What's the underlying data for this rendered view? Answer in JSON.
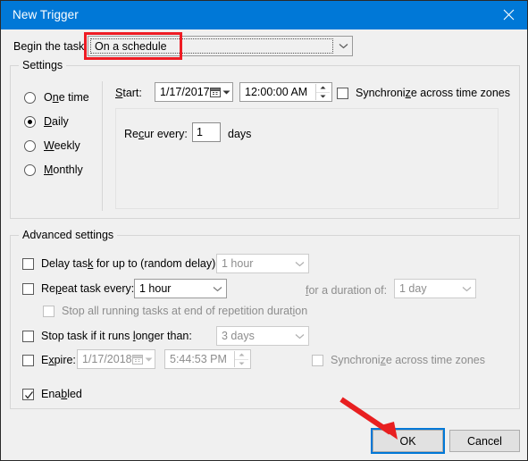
{
  "window": {
    "title": "New Trigger",
    "close_icon": "close-icon",
    "accent_color": "#0078d7",
    "body_color": "#f0f0f0"
  },
  "begin": {
    "label": "Begin the task:",
    "value": "On a schedule",
    "arrow_icon": "chevron-down-icon",
    "highlight_color": "#ee1c24"
  },
  "settings": {
    "title": "Settings",
    "radios": [
      {
        "label": "One time",
        "selected": false
      },
      {
        "label": "Daily",
        "selected": true
      },
      {
        "label": "Weekly",
        "selected": false
      },
      {
        "label": "Monthly",
        "selected": false
      }
    ],
    "start": {
      "label": "Start:",
      "date": "1/17/2017",
      "time": "12:00:00 AM",
      "calendar_icon": "calendar-icon",
      "arrow_icon": "chevron-down-icon",
      "spinner_icon": "spinner-up-down-icon"
    },
    "sync": {
      "label": "Synchronize across time zones",
      "checked": false
    },
    "recur": {
      "label": "Recur every:",
      "value": "1",
      "unit": "days"
    }
  },
  "advanced": {
    "title": "Advanced settings",
    "delay": {
      "label": "Delay task for up to (random delay):",
      "checked": false,
      "value": "1 hour",
      "arrow_icon": "chevron-down-icon"
    },
    "repeat": {
      "label": "Repeat task every:",
      "checked": false,
      "value": "1 hour",
      "duration_label": "for a duration of:",
      "duration_value": "1 day",
      "arrow_icon": "chevron-down-icon"
    },
    "stop_all": {
      "label": "Stop all running tasks at end of repetition duration",
      "checked": false
    },
    "stop_task": {
      "label": "Stop task if it runs longer than:",
      "checked": false,
      "value": "3 days",
      "arrow_icon": "chevron-down-icon"
    },
    "expire": {
      "label": "Expire:",
      "checked": false,
      "date": "1/17/2018",
      "time": "5:44:53 PM",
      "calendar_icon": "calendar-icon",
      "arrow_icon": "chevron-down-icon",
      "spinner_icon": "spinner-up-down-icon",
      "sync_label": "Synchronize across time zones",
      "sync_checked": false
    },
    "enabled": {
      "label": "Enabled",
      "checked": true
    }
  },
  "footer": {
    "ok_label": "OK",
    "cancel_label": "Cancel",
    "focus_color": "#0078d7",
    "annotation_arrow_color": "#e81f20"
  }
}
